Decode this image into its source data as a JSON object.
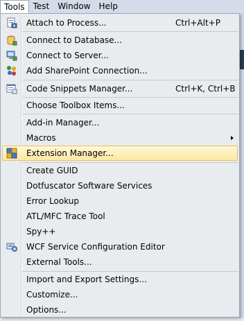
{
  "menubar": {
    "items": [
      {
        "label": "Tools",
        "active": true
      },
      {
        "label": "Test"
      },
      {
        "label": "Window"
      },
      {
        "label": "Help"
      }
    ]
  },
  "menu": {
    "items": [
      {
        "label": "Attach to Process...",
        "shortcut": "Ctrl+Alt+P",
        "icon": "attach-process-icon"
      },
      {
        "label": "Connect to Database...",
        "icon": "database-icon"
      },
      {
        "label": "Connect to Server...",
        "icon": "server-icon"
      },
      {
        "label": "Add SharePoint Connection...",
        "icon": "sharepoint-icon"
      },
      {
        "label": "Code Snippets Manager...",
        "shortcut": "Ctrl+K, Ctrl+B",
        "icon": "code-snippets-icon"
      },
      {
        "label": "Choose Toolbox Items..."
      },
      {
        "label": "Add-in Manager..."
      },
      {
        "label": "Macros",
        "submenu": true
      },
      {
        "label": "Extension Manager...",
        "icon": "extension-manager-icon",
        "highlighted": true
      },
      {
        "label": "Create GUID"
      },
      {
        "label": "Dotfuscator Software Services"
      },
      {
        "label": "Error Lookup"
      },
      {
        "label": "ATL/MFC Trace Tool"
      },
      {
        "label": "Spy++"
      },
      {
        "label": "WCF Service Configuration Editor",
        "icon": "wcf-config-icon"
      },
      {
        "label": "External Tools..."
      },
      {
        "label": "Import and Export Settings..."
      },
      {
        "label": "Customize..."
      },
      {
        "label": "Options..."
      }
    ]
  },
  "colors": {
    "highlight_top": "#fef8d6",
    "highlight_bottom": "#fde9a4",
    "highlight_border": "#e5c365",
    "menu_bg": "#e9ecee",
    "menubar_bg": "#d6dbe9"
  }
}
